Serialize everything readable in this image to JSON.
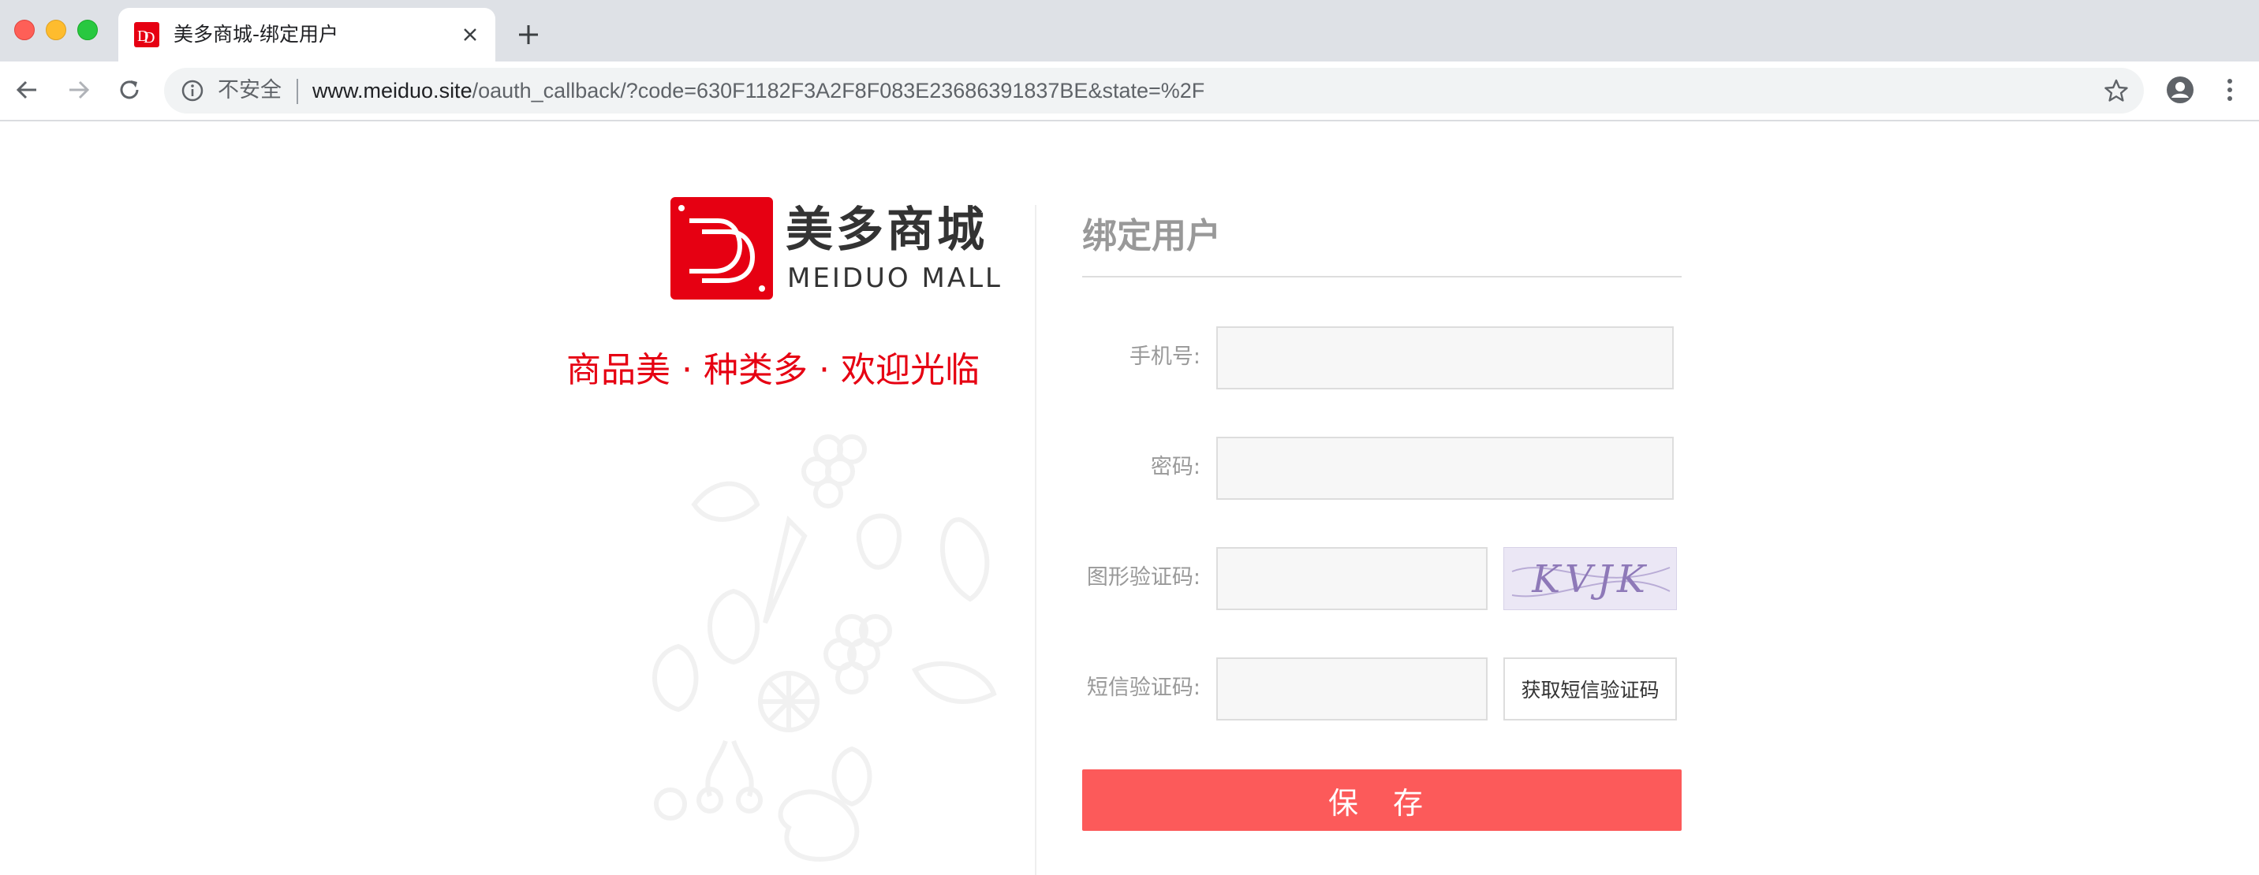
{
  "browser": {
    "tab_title": "美多商城-绑定用户",
    "security_label": "不安全",
    "url_host": "www.meiduo.site",
    "url_path": "/oauth_callback/?code=630F1182F3A2F8F083E23686391837BE&state=%2F"
  },
  "brand": {
    "name_cn": "美多商城",
    "name_en": "MEIDUO MALL",
    "slogan": "商品美 · 种类多 · 欢迎光临",
    "color": "#e60012"
  },
  "form": {
    "title": "绑定用户",
    "mobile_label": "手机号:",
    "mobile_value": "",
    "password_label": "密码:",
    "password_value": "",
    "image_code_label": "图形验证码:",
    "image_code_value": "",
    "captcha_text": "KVJK",
    "sms_code_label": "短信验证码:",
    "sms_code_value": "",
    "sms_button_label": "获取短信验证码",
    "save_button_label": "保 存",
    "save_button_color": "#fc5a5a"
  }
}
